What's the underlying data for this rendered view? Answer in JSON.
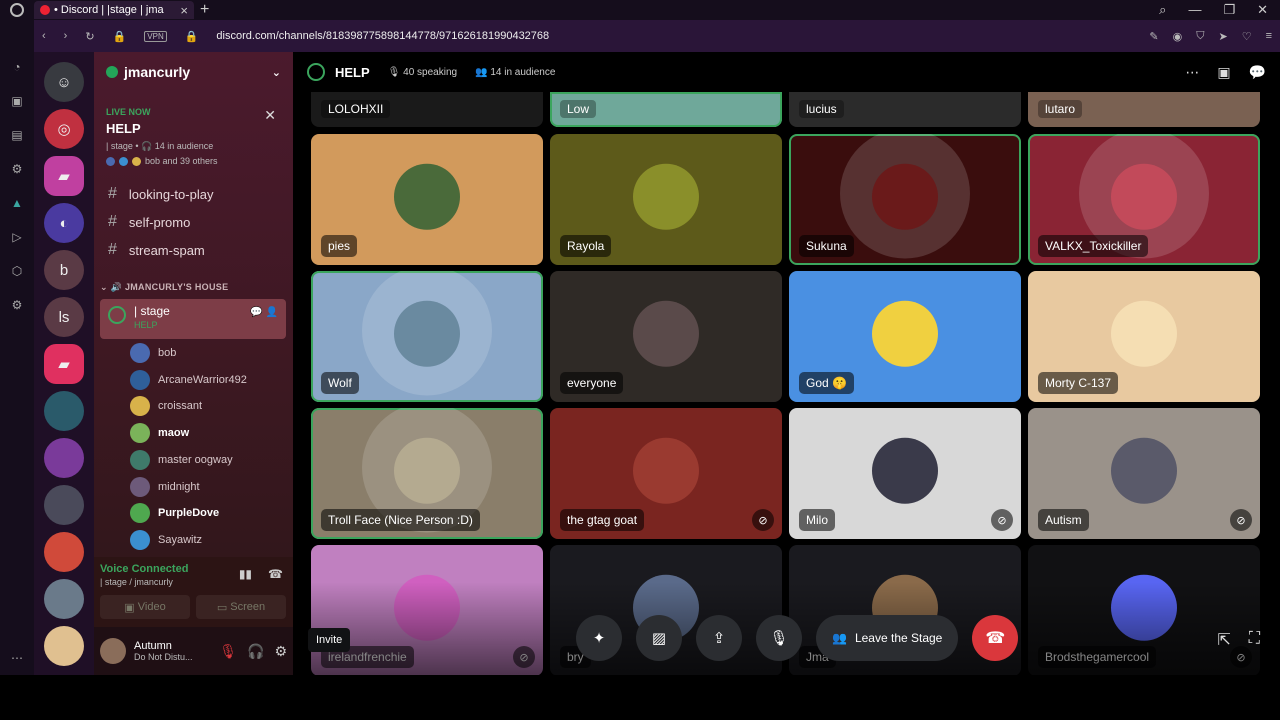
{
  "browser": {
    "tab_title": "• Discord | |stage | jma",
    "url": "discord.com/channels/818398775898144778/971626181990432768",
    "vpn": "VPN"
  },
  "server_header": {
    "name": "jmancurly"
  },
  "live_now": {
    "label": "LIVE NOW",
    "title": "HELP",
    "subtitle": "| stage • 🎧 14 in audience",
    "participants": "bob and 39 others"
  },
  "text_channels": [
    "looking-to-play",
    "self-promo",
    "stream-spam"
  ],
  "category": "JMANCURLY'S HOUSE",
  "stage_channel": {
    "name": "| stage",
    "topic": "HELP"
  },
  "members": [
    {
      "name": "bob",
      "bold": false,
      "color": "#4a6ab0"
    },
    {
      "name": "ArcaneWarrior492",
      "bold": false,
      "color": "#2f5f9a"
    },
    {
      "name": "croissant",
      "bold": false,
      "color": "#d8b24a"
    },
    {
      "name": "maow",
      "bold": true,
      "color": "#7bb35a"
    },
    {
      "name": "master oogway",
      "bold": false,
      "color": "#3f7a6a"
    },
    {
      "name": "midnight",
      "bold": false,
      "color": "#6d5a7a"
    },
    {
      "name": "PurpleDove",
      "bold": true,
      "color": "#4fa84f"
    },
    {
      "name": "Sayawitz",
      "bold": false,
      "color": "#3b8fd0"
    }
  ],
  "voice": {
    "status": "Voice Connected",
    "channel": "| stage / jmancurly",
    "video": "Video",
    "screen": "Screen"
  },
  "user": {
    "name": "Autumn",
    "status": "Do Not Distu..."
  },
  "stage": {
    "title": "HELP",
    "speaking": "40 speaking",
    "audience": "14 in audience"
  },
  "top_row": [
    {
      "name": "LOLOHXII",
      "color": "#1a1a1a"
    },
    {
      "name": "Low",
      "color": "#6fa89a"
    },
    {
      "name": "lucius",
      "color": "#2b2b2b"
    },
    {
      "name": "lutaro",
      "color": "#7a6152"
    }
  ],
  "tiles": [
    {
      "name": "pies",
      "bg": "#d29a5c",
      "av": "#4a6a3a",
      "speaking": false,
      "muted": false
    },
    {
      "name": "Rayola",
      "bg": "#5d5a1a",
      "av": "#8a8f2a",
      "speaking": false,
      "muted": false
    },
    {
      "name": "Sukuna",
      "bg": "#3a0d0d",
      "av": "#6a1a1a",
      "speaking": true,
      "muted": false
    },
    {
      "name": "VALKX_Toxickiller",
      "bg": "#8a2434",
      "av": "#c24a5a",
      "speaking": true,
      "muted": false
    },
    {
      "name": "Wolf",
      "bg": "#8aa7c8",
      "av": "#6a8aa0",
      "speaking": true,
      "muted": false
    },
    {
      "name": "everyone",
      "bg": "#2f2a26",
      "av": "#5a4a4a",
      "speaking": false,
      "muted": false
    },
    {
      "name": "God 🤫",
      "bg": "#4a90e2",
      "av": "#f0d040",
      "speaking": false,
      "muted": false
    },
    {
      "name": "Morty C-137",
      "bg": "#e8c9a0",
      "av": "#f5deb3",
      "speaking": false,
      "muted": false
    },
    {
      "name": "Troll Face (Nice Person :D)",
      "bg": "#8a7e6a",
      "av": "#b4aa90",
      "speaking": true,
      "muted": false
    },
    {
      "name": "the gtag goat",
      "bg": "#7a2520",
      "av": "#9a3a30",
      "speaking": false,
      "muted": true
    },
    {
      "name": "Milo",
      "bg": "#d8d8d8",
      "av": "#3a3a4a",
      "speaking": false,
      "muted": true
    },
    {
      "name": "Autism",
      "bg": "#9a928a",
      "av": "#5a5a6a",
      "speaking": false,
      "muted": true
    },
    {
      "name": "irelandfrenchie",
      "bg": "#c080c0",
      "av": "#d060c0",
      "speaking": false,
      "muted": true
    },
    {
      "name": "bry",
      "bg": "#1a1a1f",
      "av": "#5a6a8a",
      "speaking": false,
      "muted": false
    },
    {
      "name": "Jma",
      "bg": "#1a1a1f",
      "av": "#8a6a4a",
      "speaking": false,
      "muted": false
    },
    {
      "name": "Brodsthegamercool",
      "bg": "#111113",
      "av": "#5865f2",
      "speaking": false,
      "muted": true
    }
  ],
  "controls": {
    "leave": "Leave the Stage",
    "invite": "Invite"
  }
}
